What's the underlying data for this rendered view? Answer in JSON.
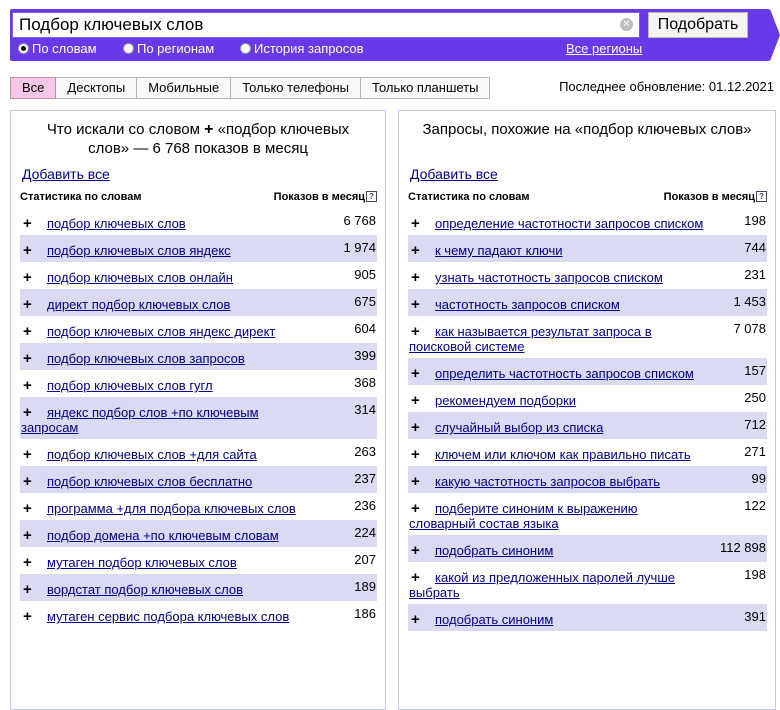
{
  "search": {
    "value": "Подбор ключевых слов",
    "submit_label": "Подобрать",
    "radios": [
      {
        "label": "По словам",
        "checked": true
      },
      {
        "label": "По регионам",
        "checked": false
      },
      {
        "label": "История запросов",
        "checked": false
      }
    ],
    "all_regions": "Все регионы"
  },
  "tabs": [
    {
      "label": "Все",
      "active": true
    },
    {
      "label": "Десктопы",
      "active": false
    },
    {
      "label": "Мобильные",
      "active": false
    },
    {
      "label": "Только телефоны",
      "active": false
    },
    {
      "label": "Только планшеты",
      "active": false
    }
  ],
  "last_update": {
    "label": "Последнее обновление:",
    "date": "01.12.2021"
  },
  "left": {
    "title_before": "Что искали со словом",
    "title_after": "«подбор ключевых слов» — 6 768 показов в месяц",
    "add_all": "Добавить все",
    "col_words": "Статистика по словам",
    "col_count": "Показов в месяц",
    "rows": [
      {
        "text": "подбор ключевых слов",
        "count": "6 768"
      },
      {
        "text": "подбор ключевых слов яндекс",
        "count": "1 974"
      },
      {
        "text": "подбор ключевых слов онлайн",
        "count": "905"
      },
      {
        "text": "директ подбор ключевых слов",
        "count": "675"
      },
      {
        "text": "подбор ключевых слов яндекс директ",
        "count": "604"
      },
      {
        "text": "подбор ключевых слов запросов",
        "count": "399"
      },
      {
        "text": "подбор ключевых слов гугл",
        "count": "368"
      },
      {
        "text": "яндекс подбор слов +по ключевым запросам",
        "count": "314"
      },
      {
        "text": "подбор ключевых слов +для сайта",
        "count": "263"
      },
      {
        "text": "подбор ключевых слов бесплатно",
        "count": "237"
      },
      {
        "text": "программа +для подбора ключевых слов",
        "count": "236"
      },
      {
        "text": "подбор домена +по ключевым словам",
        "count": "224"
      },
      {
        "text": "мутаген подбор ключевых слов",
        "count": "207"
      },
      {
        "text": "вордстат подбор ключевых слов",
        "count": "189"
      },
      {
        "text": "мутаген сервис подбора ключевых слов",
        "count": "186"
      }
    ]
  },
  "right": {
    "title": "Запросы, похожие на «подбор ключевых слов»",
    "add_all": "Добавить все",
    "col_words": "Статистика по словам",
    "col_count": "Показов в месяц",
    "rows": [
      {
        "text": "определение частотности запросов списком",
        "count": "198"
      },
      {
        "text": "к чему падают ключи",
        "count": "744"
      },
      {
        "text": "узнать частотность запросов списком",
        "count": "231"
      },
      {
        "text": "частотность запросов списком",
        "count": "1 453"
      },
      {
        "text": "как называется результат запроса в поисковой системе",
        "count": "7 078"
      },
      {
        "text": "определить частотность запросов списком",
        "count": "157"
      },
      {
        "text": "рекомендуем подборки",
        "count": "250"
      },
      {
        "text": "случайный выбор из списка",
        "count": "712"
      },
      {
        "text": "ключем или ключом как правильно писать",
        "count": "271"
      },
      {
        "text": "какую частотность запросов выбрать",
        "count": "99"
      },
      {
        "text": "подберите синоним к выражению словарный состав языка",
        "count": "122"
      },
      {
        "text": "подобрать синоним",
        "count": "112 898"
      },
      {
        "text": "какой из предложенных паролей лучше выбрать",
        "count": "198"
      },
      {
        "text": "подобрать синоним",
        "count": "391"
      }
    ]
  }
}
